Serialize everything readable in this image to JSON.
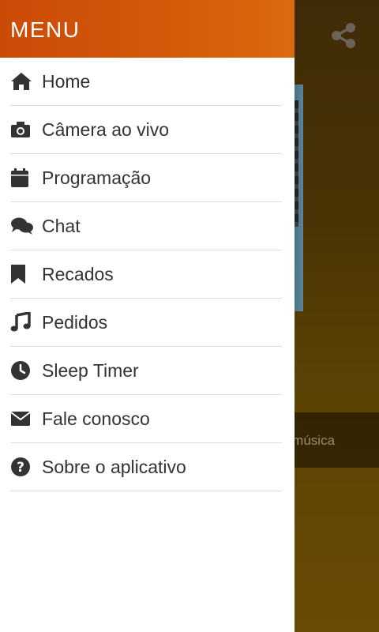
{
  "drawer": {
    "title": "MENU",
    "items": [
      {
        "label": "Home",
        "icon": "home-icon"
      },
      {
        "label": "Câmera ao vivo",
        "icon": "camera-icon"
      },
      {
        "label": "Programação",
        "icon": "calendar-icon"
      },
      {
        "label": "Chat",
        "icon": "chat-icon"
      },
      {
        "label": "Recados",
        "icon": "bookmark-icon"
      },
      {
        "label": "Pedidos",
        "icon": "music-note-icon"
      },
      {
        "label": "Sleep Timer",
        "icon": "clock-icon"
      },
      {
        "label": "Fale conosco",
        "icon": "envelope-icon"
      },
      {
        "label": "Sobre o aplicativo",
        "icon": "question-circle-icon"
      }
    ]
  },
  "background": {
    "now_playing_text": "a música",
    "share_icon": "share-icon"
  },
  "colors": {
    "header_orange": "#d45b0a",
    "menu_text": "#333333",
    "divider": "#dcdcdc"
  }
}
